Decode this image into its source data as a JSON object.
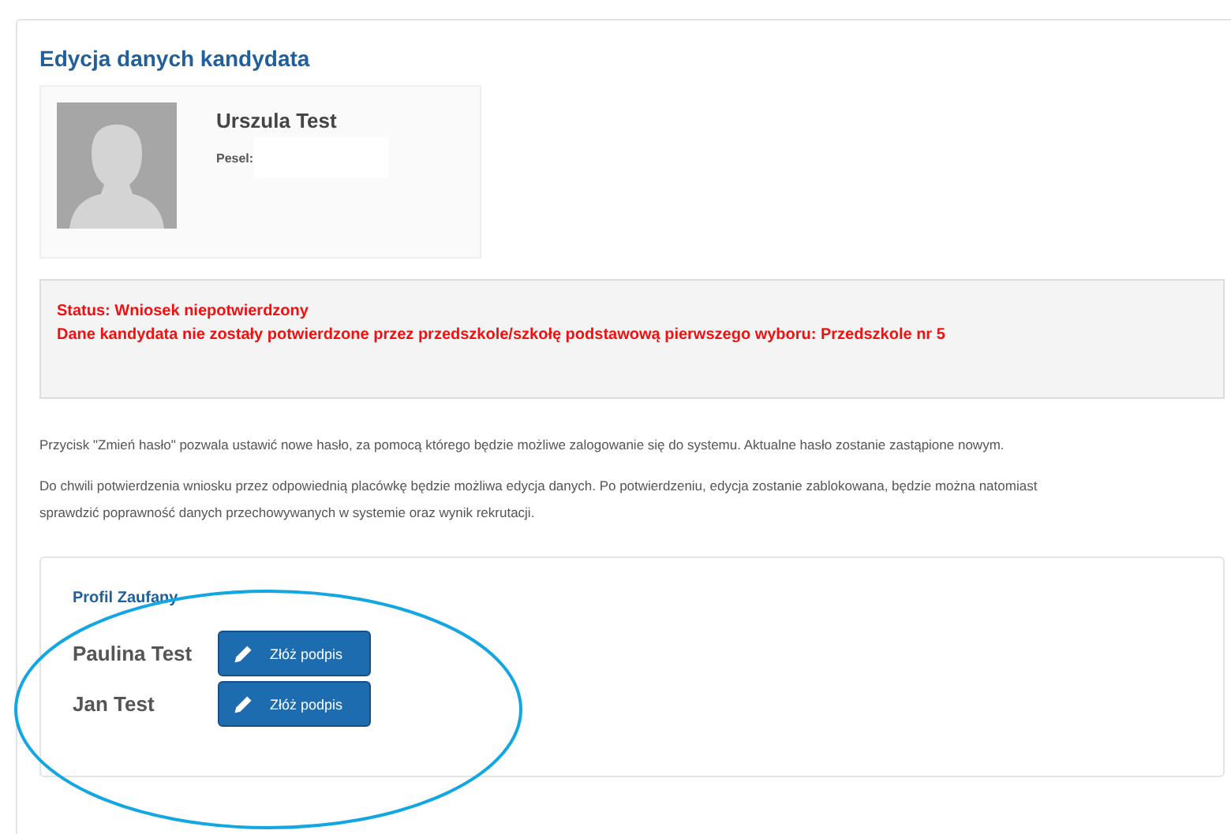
{
  "title": "Edycja danych kandydata",
  "candidate": {
    "name": "Urszula Test",
    "pesel_label": "Pesel:"
  },
  "status": {
    "line1": "Status: Wniosek niepotwierdzony",
    "line2": "Dane kandydata nie zostały potwierdzone przez przedszkole/szkołę podstawową pierwszego wyboru: Przedszkole nr 5"
  },
  "paragraphs": [
    "Przycisk \"Zmień hasło\" pozwala ustawić nowe hasło, za pomocą którego będzie możliwe zalogowanie się do systemu. Aktualne hasło zostanie zastąpione nowym.",
    "Do chwili potwierdzenia wniosku przez odpowiednią placówkę będzie możliwa edycja danych. Po potwierdzeniu, edycja zostanie zablokowana, będzie można natomiast sprawdzić poprawność danych przechowywanych w systemie oraz wynik rekrutacji."
  ],
  "trusted_profile": {
    "title": "Profil Zaufany",
    "signers": [
      {
        "name": "Paulina Test",
        "button": "Złóż podpis"
      },
      {
        "name": "Jan Test",
        "button": "Złóż podpis"
      }
    ]
  }
}
